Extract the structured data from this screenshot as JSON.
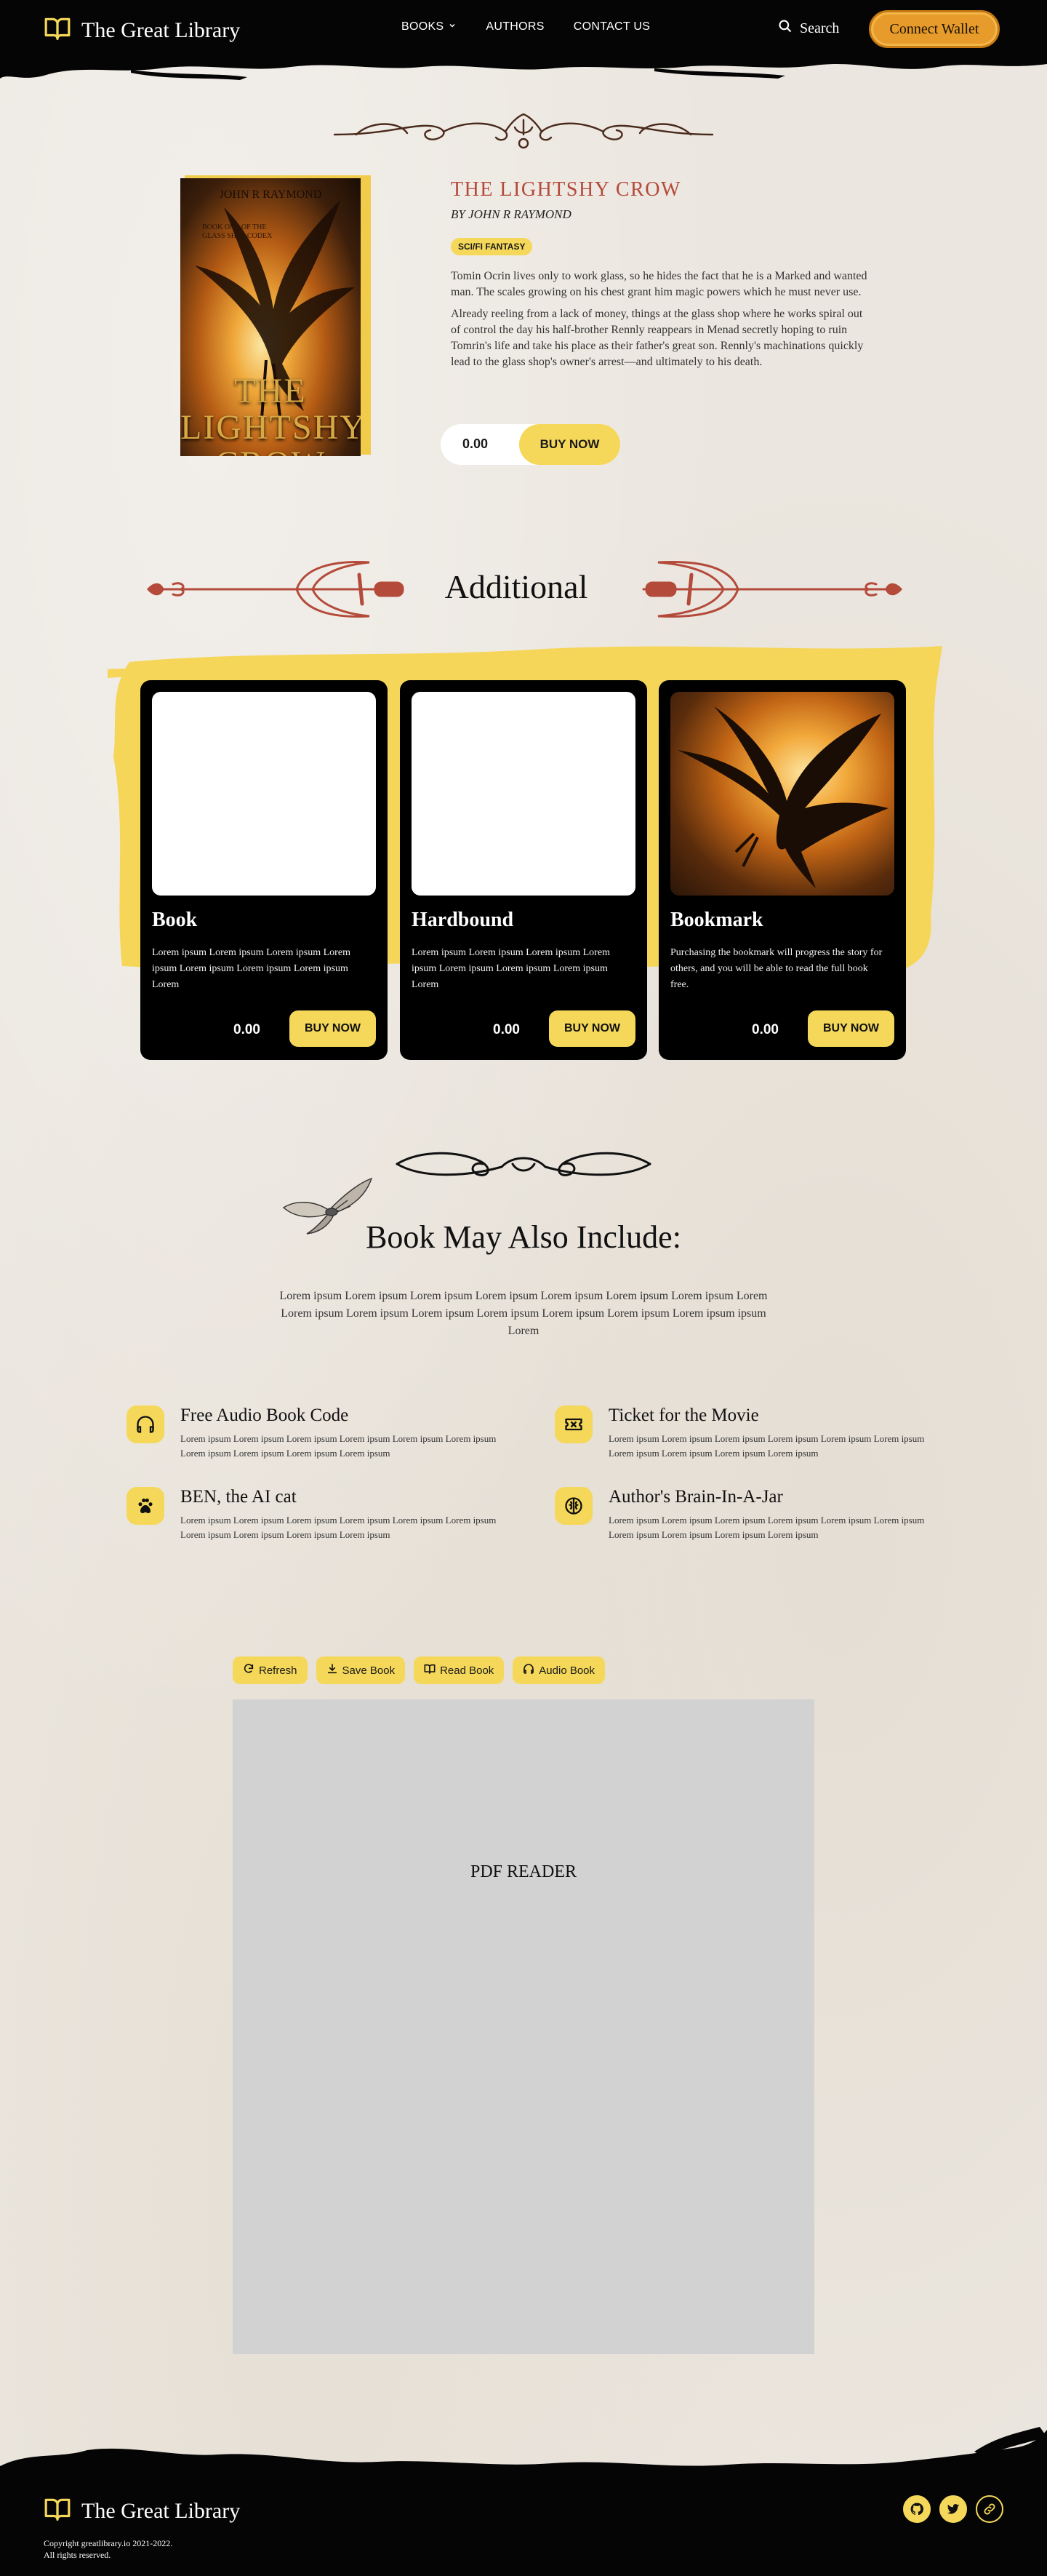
{
  "header": {
    "brand": "The Great Library",
    "nav": [
      {
        "label": "BOOKS"
      },
      {
        "label": "AUTHORS"
      },
      {
        "label": "CONTACT US"
      }
    ],
    "search_label": "Search",
    "wallet_label": "Connect  Wallet"
  },
  "book": {
    "cover_author": "JOHN R RAYMOND",
    "cover_subtitle": "BOOK ONE OF THE GLASS SHOP CODEX",
    "cover_title": "THE LIGHTSHY CROW",
    "title": "THE LIGHTSHY CROW",
    "author": "BY JOHN R RAYMOND",
    "genre": "SCI/FI FANTASY",
    "description": [
      "Tomin Ocrin lives only to work glass, so he hides the fact that he is a Marked and wanted man. The scales growing on his chest grant him magic powers which he must never use.",
      "Already reeling from a lack of money, things at the glass shop where he works spiral out of control the day his half-brother Rennly reappears in Menad secretly hoping to ruin Tomrin's life and take his place as their father's great son. Rennly's machinations quickly lead to the glass shop's owner's arrest—and ultimately to his death."
    ],
    "price": "0.00",
    "buy_label": "BUY NOW"
  },
  "additional": {
    "title": "Additional",
    "cards": [
      {
        "name": "Book",
        "description": "Lorem ipsum Lorem ipsum Lorem ipsum Lorem ipsum Lorem ipsum Lorem ipsum Lorem ipsum Lorem",
        "price": "0.00",
        "buy_label": "BUY NOW"
      },
      {
        "name": "Hardbound",
        "description": "Lorem ipsum Lorem ipsum Lorem ipsum Lorem ipsum Lorem ipsum Lorem ipsum Lorem ipsum Lorem",
        "price": "0.00",
        "buy_label": "BUY NOW"
      },
      {
        "name": "Bookmark",
        "description": "Purchasing the bookmark will progress the story for others, and you will be able to read the full book free.",
        "price": "0.00",
        "buy_label": "BUY NOW"
      }
    ]
  },
  "include": {
    "title": "Book May Also Include:",
    "description": "Lorem ipsum Lorem ipsum Lorem ipsum Lorem ipsum Lorem ipsum Lorem ipsum Lorem ipsum Lorem Lorem ipsum Lorem ipsum Lorem ipsum Lorem ipsum Lorem ipsum Lorem ipsum Lorem ipsum ipsum Lorem",
    "features": [
      {
        "icon": "headphones-icon",
        "title": "Free Audio Book Code",
        "description": "Lorem ipsum Lorem ipsum Lorem ipsum Lorem ipsum Lorem ipsum Lorem ipsum Lorem ipsum Lorem ipsum Lorem ipsum Lorem ipsum"
      },
      {
        "icon": "ticket-icon",
        "title": "Ticket for the Movie",
        "description": "Lorem ipsum Lorem ipsum Lorem ipsum Lorem ipsum Lorem ipsum Lorem ipsum Lorem ipsum Lorem ipsum Lorem ipsum Lorem ipsum"
      },
      {
        "icon": "paw-icon",
        "title": "BEN, the AI cat",
        "description": "Lorem ipsum Lorem ipsum Lorem ipsum Lorem ipsum Lorem ipsum Lorem ipsum Lorem ipsum Lorem ipsum Lorem ipsum Lorem ipsum"
      },
      {
        "icon": "brain-icon",
        "title": "Author's Brain-In-A-Jar",
        "description": "Lorem ipsum Lorem ipsum Lorem ipsum Lorem ipsum Lorem ipsum Lorem ipsum Lorem ipsum Lorem ipsum Lorem ipsum Lorem ipsum"
      }
    ]
  },
  "reader": {
    "buttons": [
      {
        "icon": "refresh-icon",
        "label": "Refresh"
      },
      {
        "icon": "download-icon",
        "label": "Save Book"
      },
      {
        "icon": "book-icon",
        "label": "Read Book"
      },
      {
        "icon": "headphones-icon",
        "label": "Audio Book"
      }
    ],
    "label": "PDF READER"
  },
  "footer": {
    "brand": "The Great Library",
    "copyright_line1": "Copyright greatlibrary.io 2021-2022.",
    "copyright_line2": "All rights reserved.",
    "socials": [
      "github-icon",
      "twitter-icon",
      "link-icon"
    ]
  },
  "colors": {
    "accent": "#f5d85a",
    "title_red": "#b44a3a",
    "wallet_orange": "#e79b2a",
    "paper": "#ebe6df",
    "dark": "#050505"
  }
}
